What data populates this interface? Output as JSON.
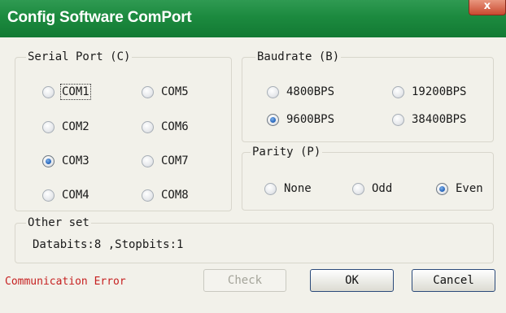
{
  "window": {
    "title": "Config Software ComPort",
    "close_label": "x"
  },
  "serial_port": {
    "title": "Serial Port (C)",
    "options": [
      {
        "label": "COM1",
        "checked": false
      },
      {
        "label": "COM5",
        "checked": false
      },
      {
        "label": "COM2",
        "checked": false
      },
      {
        "label": "COM6",
        "checked": false
      },
      {
        "label": "COM3",
        "checked": true
      },
      {
        "label": "COM7",
        "checked": false
      },
      {
        "label": "COM4",
        "checked": false
      },
      {
        "label": "COM8",
        "checked": false
      }
    ]
  },
  "baudrate": {
    "title": "Baudrate (B)",
    "options": [
      {
        "label": "4800BPS",
        "checked": false
      },
      {
        "label": "19200BPS",
        "checked": false
      },
      {
        "label": "9600BPS",
        "checked": true
      },
      {
        "label": "38400BPS",
        "checked": false
      }
    ]
  },
  "parity": {
    "title": "Parity (P)",
    "options": [
      {
        "label": "None",
        "checked": false
      },
      {
        "label": "Odd",
        "checked": false
      },
      {
        "label": "Even",
        "checked": true
      }
    ]
  },
  "other_set": {
    "title": "Other set",
    "text": "Databits:8 ,Stopbits:1"
  },
  "status": {
    "text": "Communication Error",
    "color": "#c62020"
  },
  "buttons": {
    "check": "Check",
    "ok": "OK",
    "cancel": "Cancel"
  },
  "colors": {
    "titlebar": "#1c8a3f",
    "dialog_bg": "#f2f1ea",
    "error": "#c62020"
  }
}
